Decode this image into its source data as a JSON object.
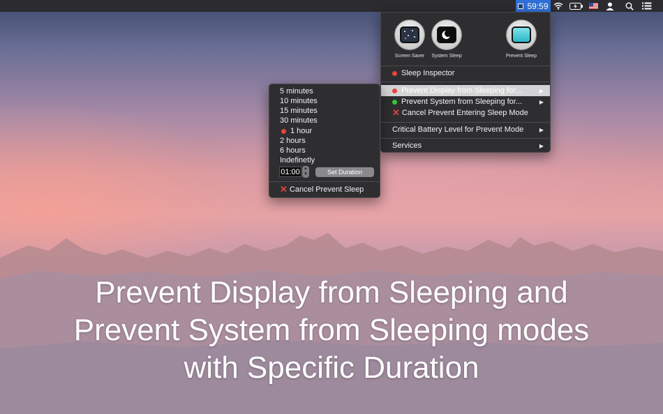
{
  "menubar": {
    "timer": "59:59",
    "icons": [
      "app-icon",
      "wifi-icon",
      "battery-icon",
      "flag-icon",
      "user-icon",
      "search-icon",
      "list-icon"
    ]
  },
  "main_menu": {
    "modes": [
      {
        "label": "Screen Saver",
        "icon": "screen-saver-icon"
      },
      {
        "label": "System Sleep",
        "icon": "system-sleep-icon"
      },
      {
        "label": "Prevent Sleep",
        "icon": "prevent-sleep-icon"
      }
    ],
    "items": [
      {
        "label": "Sleep Inspector",
        "marker": "red-dot"
      },
      {
        "label": "Prevent Display from Sleeping for...",
        "marker": "red-dot",
        "submenu": true,
        "highlighted": true
      },
      {
        "label": "Prevent System from Sleeping for...",
        "marker": "green-dot",
        "submenu": true
      },
      {
        "label": "Cancel Prevent Entering Sleep Mode",
        "marker": "x-mark"
      },
      {
        "label": "Critical Battery Level for Prevent Mode",
        "submenu": true
      },
      {
        "label": "Services",
        "submenu": true
      }
    ]
  },
  "sub_menu": {
    "durations": [
      "5 minutes",
      "10 minutes",
      "15 minutes",
      "30 minutes",
      "1 hour",
      "2 hours",
      "6 hours",
      "Indefinetly"
    ],
    "selected": "1 hour",
    "custom_value": "01:00",
    "set_duration_label": "Set Duration",
    "cancel_label": "Cancel Prevent Sleep"
  },
  "headline": {
    "line1": "Prevent Display from Sleeping and",
    "line2": "Prevent System from Sleeping modes",
    "line3": "with Specific Duration"
  },
  "colors": {
    "menu_bg": "#2e2e31",
    "highlight": "#d4d4d6",
    "timer_bg": "#2f6fd6",
    "red_dot": "#e8443d",
    "green_dot": "#38c33a"
  }
}
